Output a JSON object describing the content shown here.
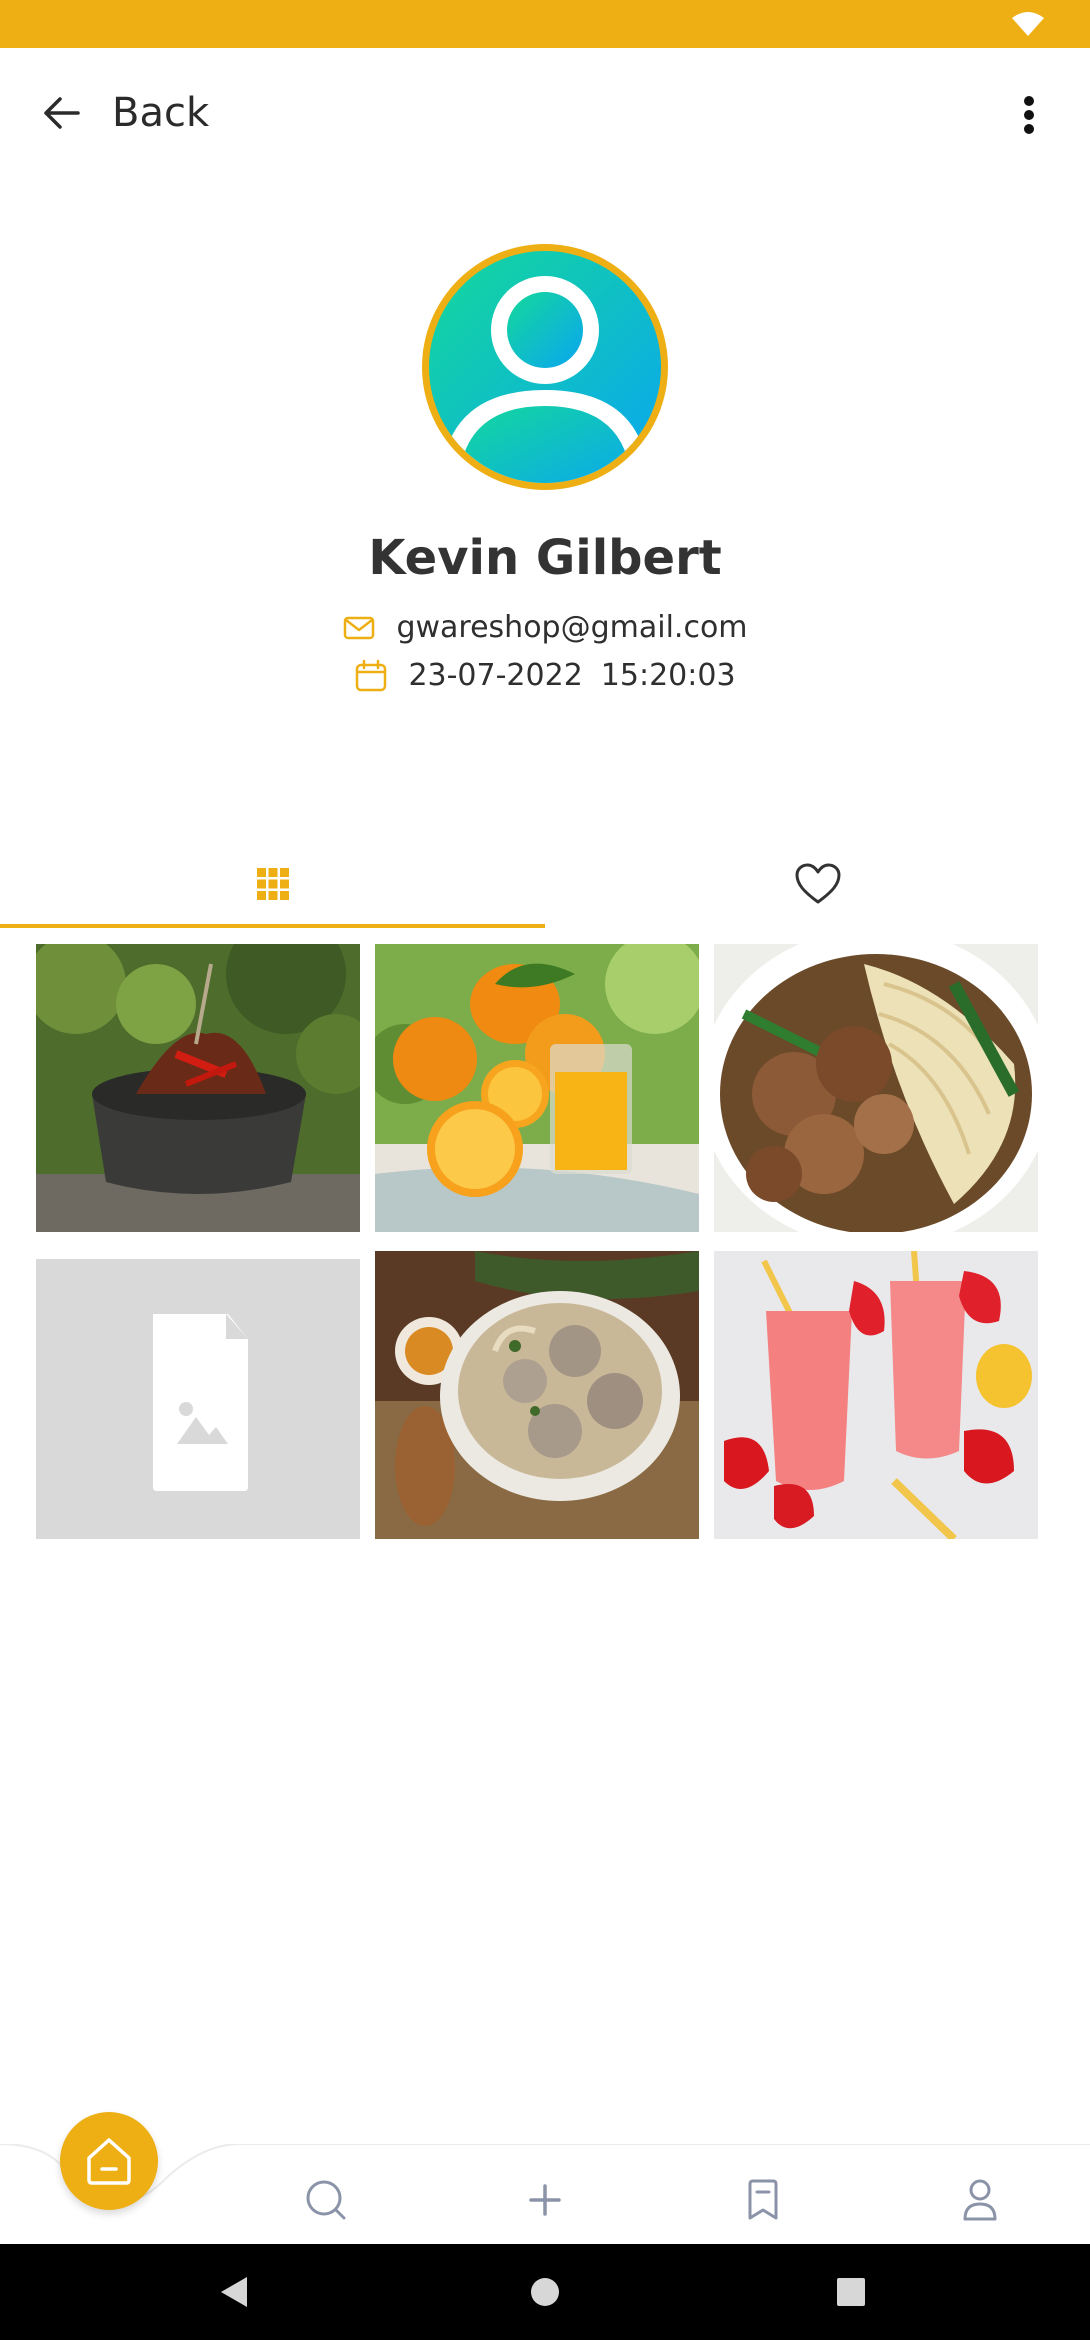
{
  "header": {
    "back_label": "Back"
  },
  "profile": {
    "name": "Kevin Gilbert",
    "email": "gwareshop@gmail.com",
    "date": "23-07-2022",
    "time": "15:20:03"
  },
  "tabs": [
    {
      "icon": "grid-icon",
      "active": true
    },
    {
      "icon": "heart-icon",
      "active": false
    }
  ],
  "posts": [
    {
      "subject": "rendang in stone bowl"
    },
    {
      "subject": "oranges and orange juice"
    },
    {
      "subject": "chicken noodle soup"
    },
    {
      "subject": "image placeholder"
    },
    {
      "subject": "meatball soup"
    },
    {
      "subject": "strawberry smoothies"
    }
  ],
  "bottom_nav": [
    "home-icon",
    "search-icon",
    "add-icon",
    "bookmark-icon",
    "profile-icon"
  ],
  "colors": {
    "accent": "#eeaf14",
    "text": "#2b2b2b",
    "placeholder": "#d9d9d9"
  }
}
